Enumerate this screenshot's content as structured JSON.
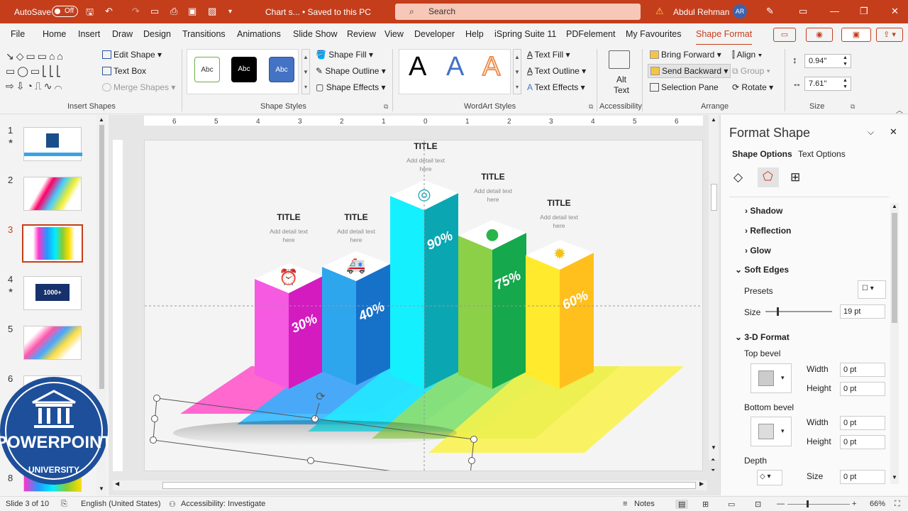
{
  "titlebar": {
    "autosave": "AutoSave",
    "toggle": "Off",
    "doc": "Chart s...  •  Saved to this PC",
    "search": "Search",
    "user": "Abdul Rehman",
    "initials": "AR"
  },
  "tabs": [
    "File",
    "Home",
    "Insert",
    "Draw",
    "Design",
    "Transitions",
    "Animations",
    "Slide Show",
    "Review",
    "View",
    "Developer",
    "Help",
    "iSpring Suite 11",
    "PDFelement",
    "My Favourites",
    "Shape Format"
  ],
  "ribbon": {
    "insert_shapes": {
      "label": "Insert Shapes",
      "edit_shape": "Edit Shape",
      "text_box": "Text Box",
      "merge_shapes": "Merge Shapes"
    },
    "shape_styles": {
      "label": "Shape Styles",
      "abc": "Abc",
      "fill": "Shape Fill",
      "outline": "Shape Outline",
      "effects": "Shape Effects"
    },
    "wordart": {
      "label": "WordArt Styles",
      "letter": "A",
      "fill": "Text Fill",
      "outline": "Text Outline",
      "effects": "Text Effects"
    },
    "accessibility": {
      "label": "Accessibility",
      "alt": "Alt",
      "text": "Text"
    },
    "arrange": {
      "label": "Arrange",
      "bring": "Bring Forward",
      "send": "Send Backward",
      "pane": "Selection Pane",
      "align": "Align",
      "group": "Group",
      "rotate": "Rotate"
    },
    "size": {
      "label": "Size",
      "height": "0.94\"",
      "width": "7.61\""
    }
  },
  "slides": [
    "1",
    "2",
    "3",
    "4",
    "5",
    "6",
    "7",
    "8"
  ],
  "chart": {
    "bars": [
      {
        "title": "TITLE",
        "detail1": "Add detail text",
        "detail2": "here",
        "value": "30%"
      },
      {
        "title": "TITLE",
        "detail1": "Add detail text",
        "detail2": "here",
        "value": "40%"
      },
      {
        "title": "TITLE",
        "detail1": "Add detail text",
        "detail2": "here",
        "value": "90%"
      },
      {
        "title": "TITLE",
        "detail1": "Add detail text",
        "detail2": "here",
        "value": "75%"
      },
      {
        "title": "TITLE",
        "detail1": "Add detail text",
        "detail2": "here",
        "value": "60%"
      }
    ]
  },
  "logo": {
    "line1": "POWERPOINT",
    "line2": "UNIVERSITY"
  },
  "ruler_marks": [
    "6",
    "5",
    "4",
    "3",
    "2",
    "1",
    "0",
    "1",
    "2",
    "3",
    "4",
    "5",
    "6"
  ],
  "format_pane": {
    "title": "Format Shape",
    "tab1": "Shape Options",
    "tab2": "Text Options",
    "shadow": "Shadow",
    "reflection": "Reflection",
    "glow": "Glow",
    "soft_edges": "Soft Edges",
    "presets": "Presets",
    "size": "Size",
    "size_value": "19 pt",
    "threed": "3-D Format",
    "top_bevel": "Top bevel",
    "bottom_bevel": "Bottom bevel",
    "width": "Width",
    "height": "Height",
    "depth": "Depth",
    "zero": "0 pt"
  },
  "status": {
    "slide": "Slide 3 of 10",
    "language": "English (United States)",
    "access": "Accessibility: Investigate",
    "notes": "Notes",
    "zoom": "66%"
  }
}
